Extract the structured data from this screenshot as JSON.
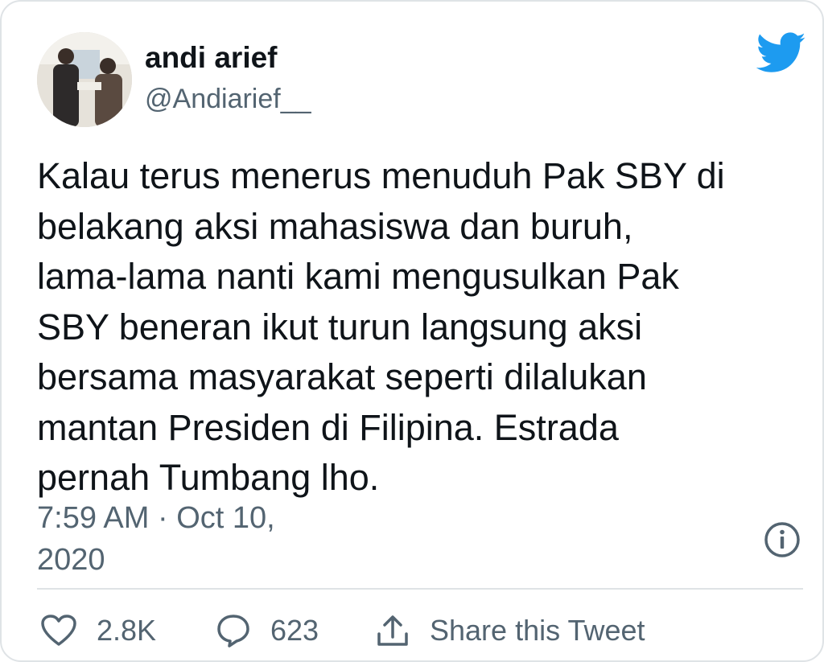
{
  "author": {
    "name": "andi arief",
    "handle": "@Andiarief__"
  },
  "tweet": {
    "text": "Kalau terus menerus menuduh Pak SBY di\nbelakang aksi mahasiswa dan buruh,\nlama-lama nanti kami mengusulkan Pak\nSBY beneran ikut turun langsung aksi\nbersama masyarakat seperti dilalukan\nmantan Presiden di Filipina. Estrada\npernah Tumbang lho.",
    "timestamp_line1": "7:59 AM · Oct 10,",
    "timestamp_line2": "2020"
  },
  "actions": {
    "likes": "2.8K",
    "replies": "623",
    "share_label": "Share this Tweet"
  },
  "icons": {
    "brand": "twitter-bird-icon",
    "info": "info-icon",
    "like": "heart-icon",
    "reply": "speech-bubble-icon",
    "share": "share-icon"
  },
  "colors": {
    "brand_blue": "#1d9bf0",
    "text_primary": "#0f1419",
    "text_secondary": "#536471",
    "border": "#dfe3e6"
  }
}
